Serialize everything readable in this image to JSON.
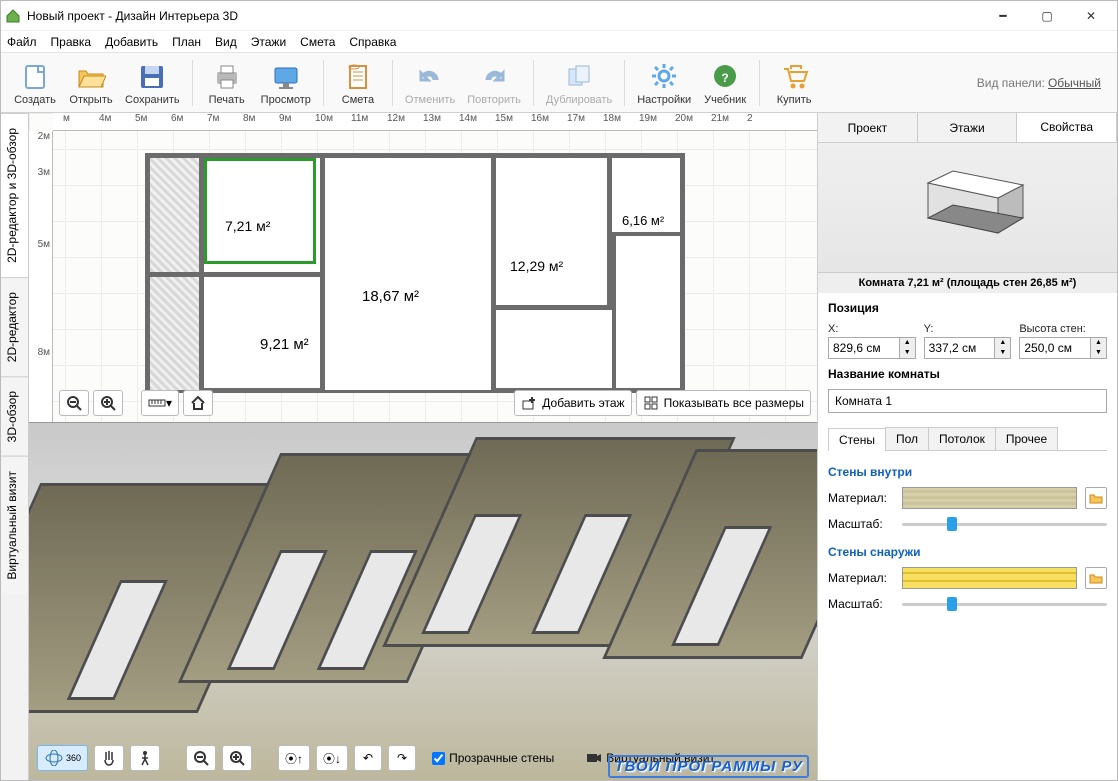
{
  "title": "Новый проект - Дизайн Интерьера 3D",
  "menu": [
    "Файл",
    "Правка",
    "Добавить",
    "План",
    "Вид",
    "Этажи",
    "Смета",
    "Справка"
  ],
  "toolbar": [
    {
      "id": "create",
      "label": "Создать",
      "dis": false
    },
    {
      "id": "open",
      "label": "Открыть",
      "dis": false
    },
    {
      "id": "save",
      "label": "Сохранить",
      "dis": false
    },
    {
      "sep": true
    },
    {
      "id": "print",
      "label": "Печать",
      "dis": false
    },
    {
      "id": "preview",
      "label": "Просмотр",
      "dis": false
    },
    {
      "sep": true
    },
    {
      "id": "est",
      "label": "Смета",
      "dis": false
    },
    {
      "sep": true
    },
    {
      "id": "undo",
      "label": "Отменить",
      "dis": true
    },
    {
      "id": "redo",
      "label": "Повторить",
      "dis": true
    },
    {
      "sep": true
    },
    {
      "id": "dup",
      "label": "Дублировать",
      "dis": true
    },
    {
      "sep": true
    },
    {
      "id": "settings",
      "label": "Настройки",
      "dis": false
    },
    {
      "id": "manual",
      "label": "Учебник",
      "dis": false
    },
    {
      "sep": true
    },
    {
      "id": "buy",
      "label": "Купить",
      "dis": false
    }
  ],
  "panel_mode_label": "Вид панели:",
  "panel_mode_value": "Обычный",
  "left_tabs": [
    "2D-редактор и 3D-обзор",
    "2D-редактор",
    "3D-обзор",
    "Виртуальный визит"
  ],
  "ruler_h": [
    "м",
    "4м",
    "5м",
    "6м",
    "7м",
    "8м",
    "9м",
    "10м",
    "11м",
    "12м",
    "13м",
    "14м",
    "15м",
    "16м",
    "17м",
    "18м",
    "19м",
    "20м",
    "21м",
    "2"
  ],
  "ruler_v": [
    "2м",
    "3м",
    "",
    "5м",
    "",
    "",
    "8м"
  ],
  "rooms": {
    "r1": "7,21 м²",
    "r2": "18,67 м²",
    "r3": "12,29 м²",
    "r4": "9,21 м²",
    "r5": "6,16 м²"
  },
  "ctrls2d": {
    "add_floor": "Добавить этаж",
    "show_dim": "Показывать все размеры"
  },
  "bar3d": {
    "transparent": "Прозрачные стены",
    "virtual": "Виртуальный визит"
  },
  "right_tabs": [
    "Проект",
    "Этажи",
    "Свойства"
  ],
  "info": "Комната 7,21 м²  (площадь стен 26,85 м²)",
  "pos_label": "Позиция",
  "pos": {
    "xl": "X:",
    "yl": "Y:",
    "hl": "Высота стен:",
    "x": "829,6 см",
    "y": "337,2 см",
    "h": "250,0 см"
  },
  "name_label": "Название комнаты",
  "name_value": "Комната 1",
  "subtabs": [
    "Стены",
    "Пол",
    "Потолок",
    "Прочее"
  ],
  "sec_in": "Стены внутри",
  "sec_out": "Стены снаружи",
  "mat_label": "Материал:",
  "scale_label": "Масштаб:",
  "watermark": "ТВОИ ПРОГРАММЫ РУ"
}
